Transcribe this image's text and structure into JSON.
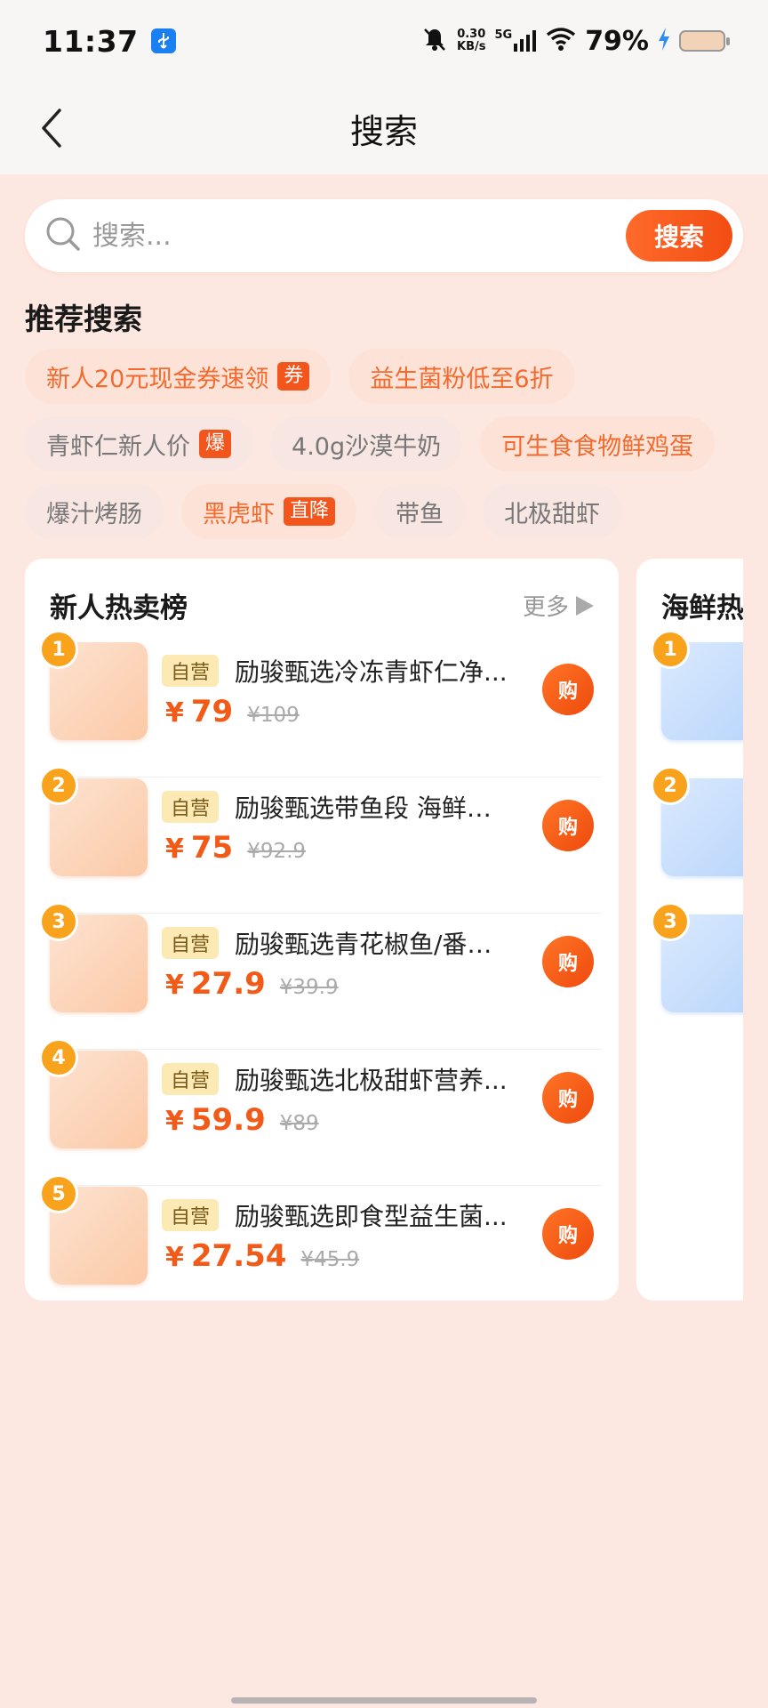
{
  "status_bar": {
    "time": "11:37",
    "usb_icon": "usb-icon",
    "net_speed_value": "0.30",
    "net_speed_unit": "KB/s",
    "signal_label": "5G",
    "battery_percent": "79%"
  },
  "nav": {
    "title": "搜索"
  },
  "search": {
    "placeholder": "搜索...",
    "button_label": "搜索"
  },
  "recommend": {
    "title": "推荐搜索",
    "rows": [
      [
        {
          "label": "新人20元现金券速领",
          "badge": "券",
          "hot": true
        },
        {
          "label": "益生菌粉低至6折",
          "badge": "",
          "hot": true
        }
      ],
      [
        {
          "label": "青虾仁新人价",
          "badge": "爆",
          "hot": false
        },
        {
          "label": "4.0g沙漠牛奶",
          "badge": "",
          "hot": false
        },
        {
          "label": "可生食食物鲜鸡蛋",
          "badge": "",
          "hot": true
        }
      ],
      [
        {
          "label": "爆汁烤肠",
          "badge": "",
          "hot": false
        },
        {
          "label": "黑虎虾",
          "badge": "直降",
          "hot": true
        },
        {
          "label": "带鱼",
          "badge": "",
          "hot": false
        },
        {
          "label": "北极甜虾",
          "badge": "",
          "hot": false
        }
      ]
    ]
  },
  "rank_card": {
    "title": "新人热卖榜",
    "more_label": "更多",
    "items": [
      {
        "rank": "1",
        "tag": "自营",
        "name": "励骏甄选冷冻青虾仁净...",
        "currency": "¥",
        "price": "79",
        "orig_price": "¥109",
        "buy_label": "购"
      },
      {
        "rank": "2",
        "tag": "自营",
        "name": "励骏甄选带鱼段 海鲜…",
        "currency": "¥",
        "price": "75",
        "orig_price": "¥92.9",
        "buy_label": "购"
      },
      {
        "rank": "3",
        "tag": "自营",
        "name": "励骏甄选青花椒鱼/番…",
        "currency": "¥",
        "price": "27.9",
        "orig_price": "¥39.9",
        "buy_label": "购"
      },
      {
        "rank": "4",
        "tag": "自营",
        "name": "励骏甄选北极甜虾营养...",
        "currency": "¥",
        "price": "59.9",
        "orig_price": "¥89",
        "buy_label": "购"
      },
      {
        "rank": "5",
        "tag": "自营",
        "name": "励骏甄选即食型益生菌...",
        "currency": "¥",
        "price": "27.54",
        "orig_price": "¥45.9",
        "buy_label": "购"
      }
    ]
  },
  "second_card": {
    "title": "海鲜热",
    "ranks": [
      "1",
      "2",
      "3"
    ]
  }
}
